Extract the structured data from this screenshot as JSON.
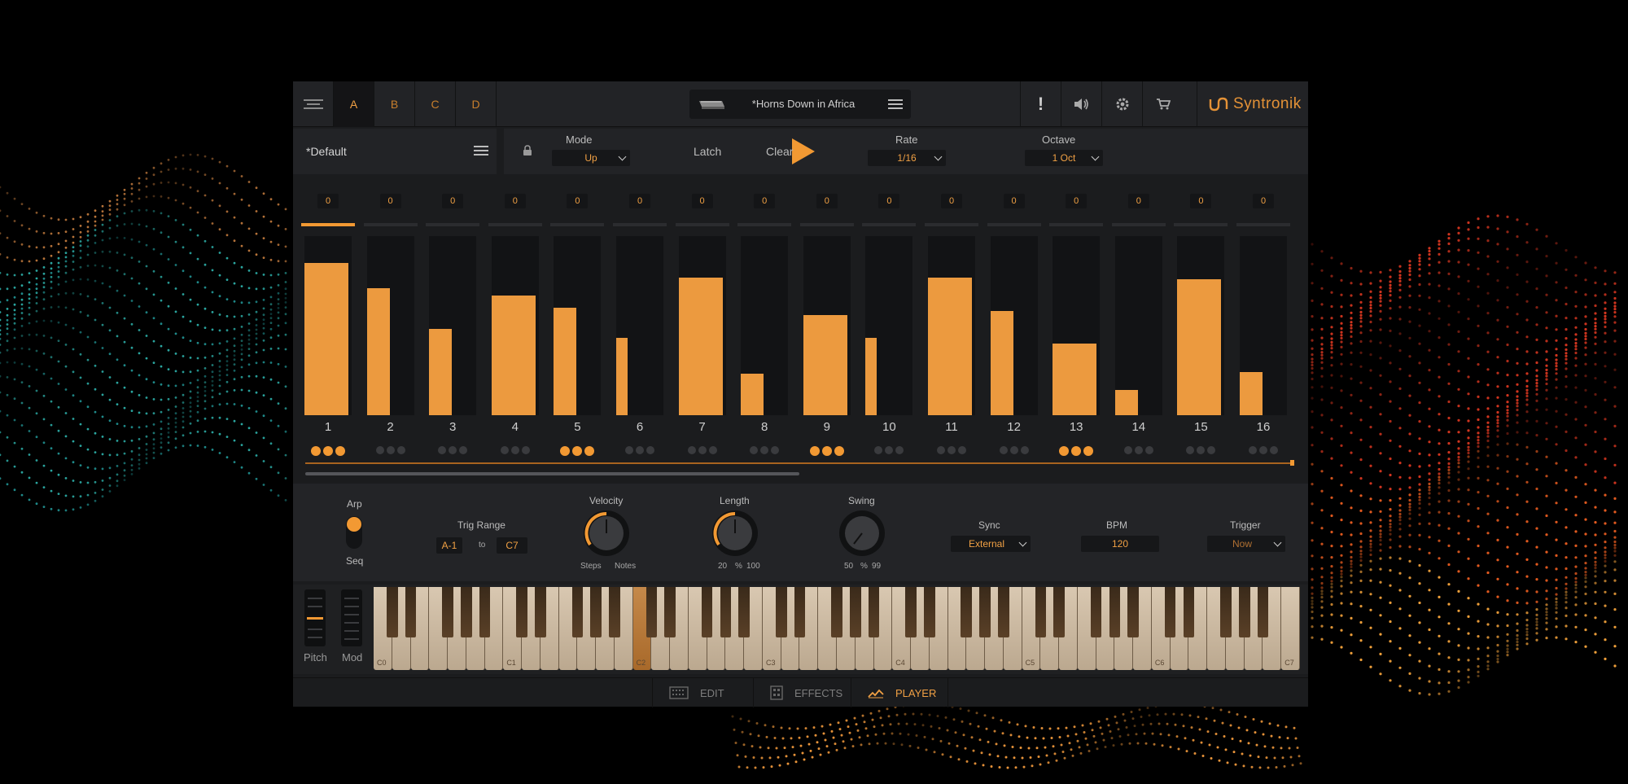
{
  "topbar": {
    "slots": [
      "A",
      "B",
      "C",
      "D"
    ],
    "active_slot": "A",
    "preset_name": "*Horns Down in Africa",
    "icons": [
      "menu-icon",
      "alert-icon",
      "speaker-icon",
      "gear-icon",
      "cart-icon"
    ],
    "alert_glyph": "!",
    "brand": "Syntronik"
  },
  "control_bar": {
    "pattern_preset": "*Default",
    "mode_label": "Mode",
    "mode_value": "Up",
    "latch_label": "Latch",
    "clear_label": "Clear",
    "rate_label": "Rate",
    "rate_value": "1/16",
    "octave_label": "Octave",
    "octave_value": "1 Oct"
  },
  "sequencer": {
    "selected_step": 1,
    "steps": [
      {
        "n": "1",
        "offset": "0",
        "velocity": 0.85,
        "width": "wide",
        "dots_on": true
      },
      {
        "n": "2",
        "offset": "0",
        "velocity": 0.71,
        "width": "narrow",
        "dots_on": false
      },
      {
        "n": "3",
        "offset": "0",
        "velocity": 0.48,
        "width": "narrow",
        "dots_on": false
      },
      {
        "n": "4",
        "offset": "0",
        "velocity": 0.67,
        "width": "wide",
        "dots_on": false
      },
      {
        "n": "5",
        "offset": "0",
        "velocity": 0.6,
        "width": "narrow",
        "dots_on": true
      },
      {
        "n": "6",
        "offset": "0",
        "velocity": 0.43,
        "width": "thin",
        "dots_on": false
      },
      {
        "n": "7",
        "offset": "0",
        "velocity": 0.77,
        "width": "wide",
        "dots_on": false
      },
      {
        "n": "8",
        "offset": "0",
        "velocity": 0.23,
        "width": "narrow",
        "dots_on": false
      },
      {
        "n": "9",
        "offset": "0",
        "velocity": 0.56,
        "width": "wide",
        "dots_on": true
      },
      {
        "n": "10",
        "offset": "0",
        "velocity": 0.43,
        "width": "thin",
        "dots_on": false
      },
      {
        "n": "11",
        "offset": "0",
        "velocity": 0.77,
        "width": "wide",
        "dots_on": false
      },
      {
        "n": "12",
        "offset": "0",
        "velocity": 0.58,
        "width": "narrow",
        "dots_on": false
      },
      {
        "n": "13",
        "offset": "0",
        "velocity": 0.4,
        "width": "wide",
        "dots_on": true
      },
      {
        "n": "14",
        "offset": "0",
        "velocity": 0.14,
        "width": "narrow",
        "dots_on": false
      },
      {
        "n": "15",
        "offset": "0",
        "velocity": 0.76,
        "width": "wide",
        "dots_on": false
      },
      {
        "n": "16",
        "offset": "0",
        "velocity": 0.24,
        "width": "narrow",
        "dots_on": false
      }
    ]
  },
  "params": {
    "arp_label": "Arp",
    "seq_label": "Seq",
    "trig_range_label": "Trig Range",
    "trig_low": "A-1",
    "trig_to": "to",
    "trig_high": "C7",
    "velocity_label": "Velocity",
    "velocity_min": "Steps",
    "velocity_max": "Notes",
    "length_label": "Length",
    "length_min": "20",
    "length_unit": "%",
    "length_max": "100",
    "swing_label": "Swing",
    "swing_min": "50",
    "swing_unit": "%",
    "swing_max": "99",
    "sync_label": "Sync",
    "sync_value": "External",
    "bpm_label": "BPM",
    "bpm_value": "120",
    "trigger_label": "Trigger",
    "trigger_value": "Now"
  },
  "keyboard": {
    "pitch_label": "Pitch",
    "mod_label": "Mod",
    "octave_marks": [
      "C0",
      "C1",
      "C2",
      "C3",
      "C4",
      "C5",
      "C6",
      "C7"
    ],
    "highlighted_key": "C2"
  },
  "bottom_tabs": {
    "edit": "EDIT",
    "effects": "EFFECTS",
    "player": "PLAYER",
    "active": "PLAYER"
  },
  "colors": {
    "accent": "#f29933",
    "panel": "#222326",
    "background": "#000000"
  }
}
